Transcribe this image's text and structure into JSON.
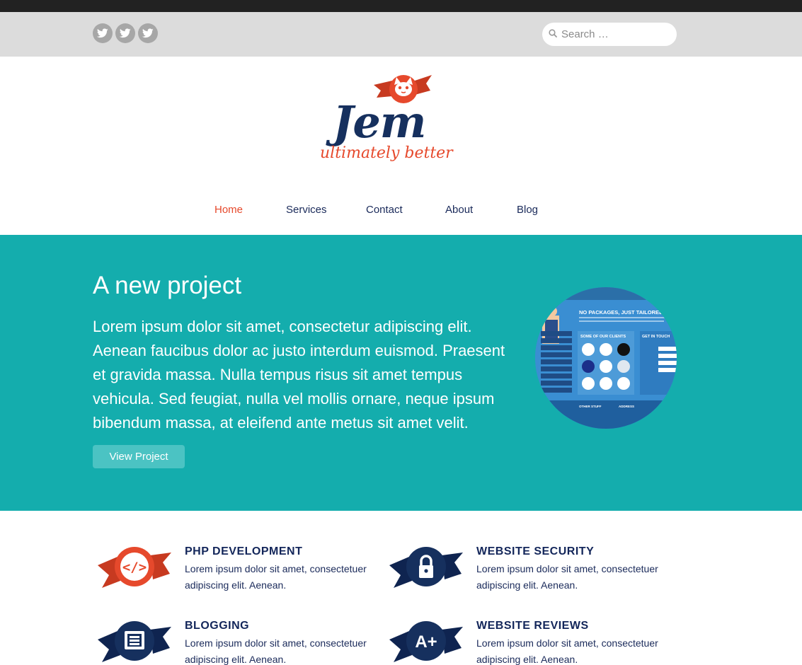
{
  "social": {
    "icons": [
      "twitter-icon",
      "twitter-icon",
      "twitter-icon"
    ]
  },
  "search": {
    "placeholder": "Search …"
  },
  "logo": {
    "name": "Jem",
    "tagline": "ultimately better"
  },
  "nav": {
    "items": [
      {
        "label": "Home",
        "active": true
      },
      {
        "label": "Services",
        "active": false
      },
      {
        "label": "Contact",
        "active": false
      },
      {
        "label": "About",
        "active": false
      },
      {
        "label": "Blog",
        "active": false
      }
    ]
  },
  "hero": {
    "title": "A new project",
    "body": "Lorem ipsum dolor sit amet, consectetur adipiscing elit. Aenean faucibus dolor ac justo interdum euismod. Praesent et gravida massa. Nulla tempus risus sit amet tempus vehicula. Sed feugiat, nulla vel mollis ornare, neque ipsum bibendum massa, at eleifend ante metus sit amet velit.",
    "button_label": "View Project",
    "thumbnail": {
      "heading": "NO PACKAGES, JUST TAILORED",
      "clients_heading": "SOME OF OUR CLIENTS",
      "contact_heading": "GET IN TOUCH",
      "menu": [
        "HOME",
        "ORGANIC SEARCH",
        "PAID SEARCH",
        "SOCIAL MEDIA",
        "WEB DESIGN",
        "CALL TRACKING",
        "ABOUT US",
        "BLOG",
        "CONTACT US"
      ],
      "footer": [
        "OTHER STUFF",
        "ADDRESS"
      ]
    }
  },
  "colors": {
    "accent": "#e6492c",
    "navy": "#16305e",
    "teal": "#14adad"
  },
  "services": [
    {
      "title": "PHP DEVELOPMENT",
      "text": "Lorem ipsum dolor sit amet, consectetuer adipiscing elit. Aenean.",
      "icon": "code-icon",
      "badge_color": "#e6492c"
    },
    {
      "title": "WEBSITE SECURITY",
      "text": "Lorem ipsum dolor sit amet, consectetuer adipiscing elit. Aenean.",
      "icon": "lock-icon",
      "badge_color": "#16305e"
    },
    {
      "title": "BLOGGING",
      "text": "Lorem ipsum dolor sit amet, consectetuer adipiscing elit. Aenean.",
      "icon": "document-icon",
      "badge_color": "#16305e"
    },
    {
      "title": "WEBSITE REVIEWS",
      "text": "Lorem ipsum dolor sit amet, consectetuer adipiscing elit. Aenean.",
      "icon": "grade-a-plus-icon",
      "badge_color": "#16305e",
      "glyph": "A+"
    }
  ]
}
